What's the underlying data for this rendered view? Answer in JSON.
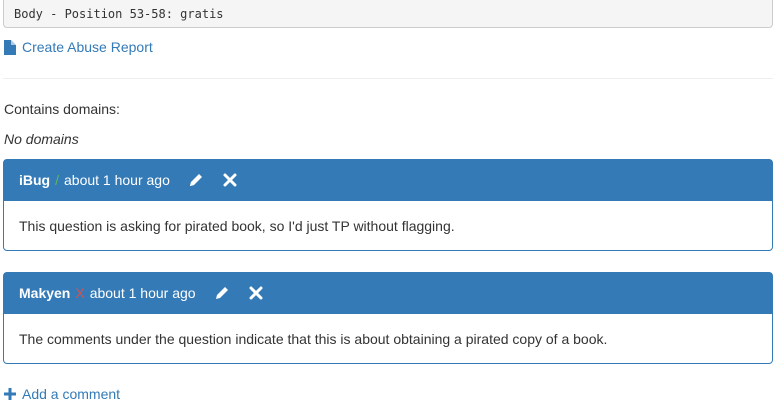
{
  "code_box": {
    "text": "Body - Position 53-58: gratis"
  },
  "abuse_link": {
    "label": "Create Abuse Report",
    "icon": "file-icon"
  },
  "domains": {
    "label": "Contains domains:",
    "value": "No domains"
  },
  "comments": [
    {
      "author": "iBug",
      "separator": "/",
      "time": "about 1 hour ago",
      "body": "This question is asking for pirated book, so I'd just TP without flagging.",
      "separator_color": "#5cb85c"
    },
    {
      "author": "Makyen",
      "separator": "X",
      "time": "about 1 hour ago",
      "body": "The comments under the question indicate that this is about obtaining a pirated copy of a book.",
      "separator_color": "#d9534f"
    }
  ],
  "add_comment": {
    "label": "Add a comment",
    "icon": "plus-icon"
  },
  "colors": {
    "accent": "#337ab7",
    "text": "#333333",
    "code_bg": "#f5f5f5"
  }
}
